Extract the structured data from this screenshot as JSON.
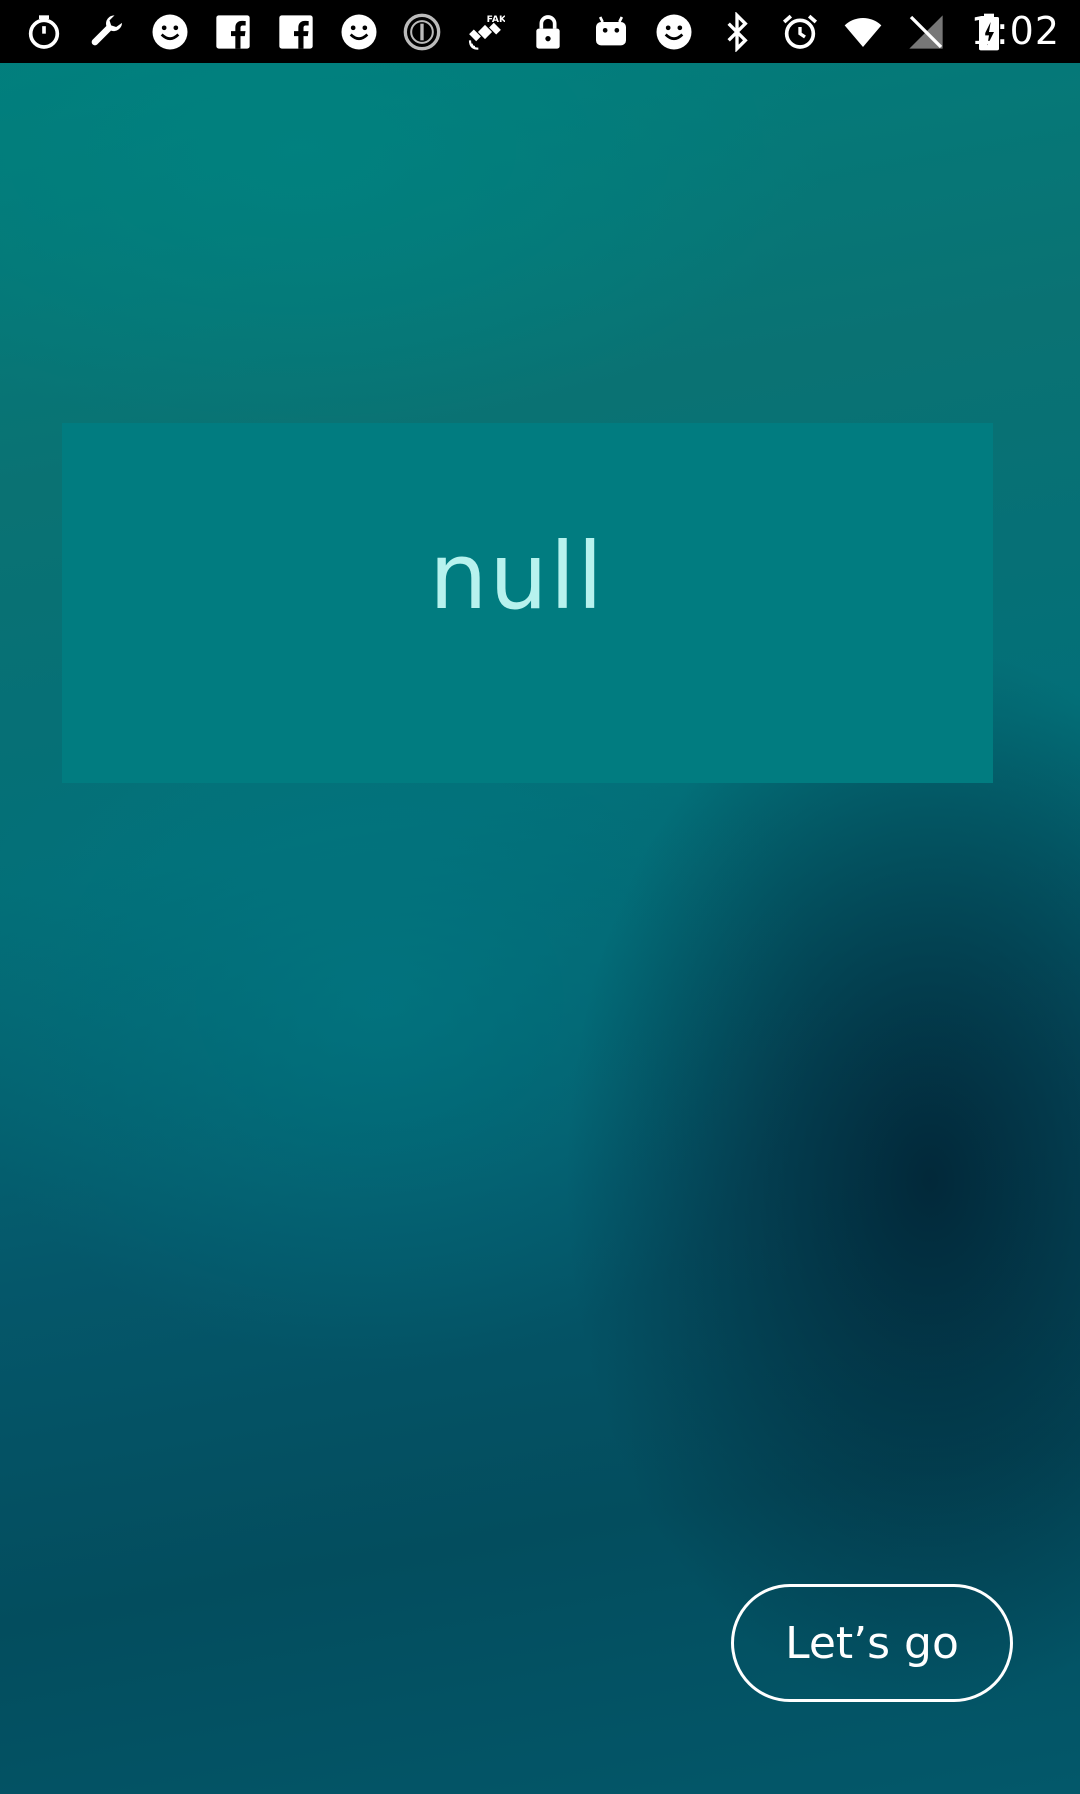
{
  "status_bar": {
    "time": "1:02",
    "icons": [
      "stopwatch-icon",
      "wrench-icon",
      "smiley-icon",
      "facebook-icon",
      "facebook-icon",
      "smiley-icon",
      "info-circle-icon",
      "fake-gps-satellite-icon",
      "lock-icon",
      "android-icon",
      "smiley-icon",
      "bluetooth-icon",
      "alarm-clock-icon",
      "wifi-icon",
      "no-signal-icon",
      "battery-charging-icon"
    ]
  },
  "card": {
    "message": "null"
  },
  "actions": {
    "primary_label": "Let’s go"
  },
  "colors": {
    "card_background": "#017c80",
    "message_text": "#b7f2ee",
    "button_border": "#ffffff",
    "status_bar": "#000000"
  }
}
